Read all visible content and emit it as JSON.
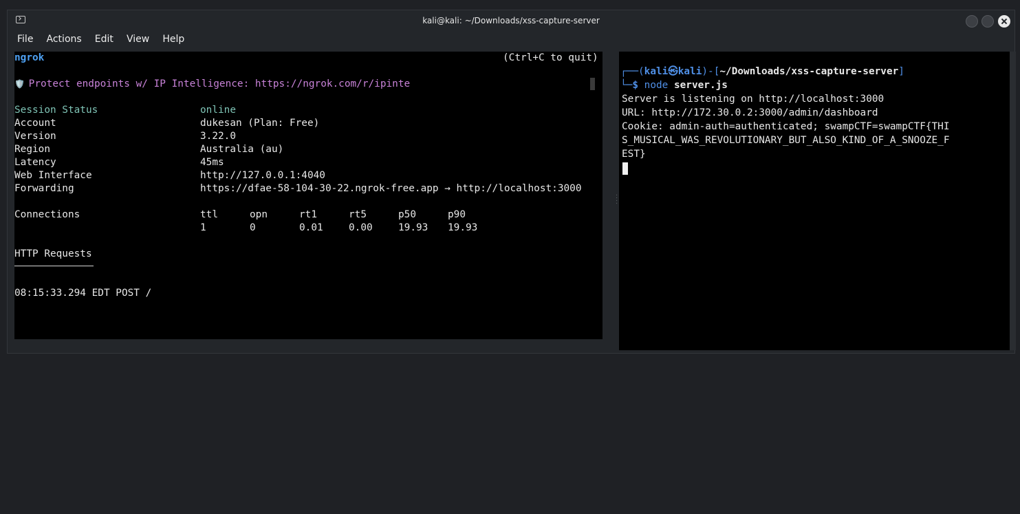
{
  "window": {
    "title": "kali@kali: ~/Downloads/xss-capture-server",
    "icon": "terminal-icon"
  },
  "menu": [
    "File",
    "Actions",
    "Edit",
    "View",
    "Help"
  ],
  "left_terminal": {
    "header_left": "ngrok",
    "header_right": "(Ctrl+C to quit)",
    "banner_icon": "🛡️",
    "banner": " Protect endpoints w/ IP Intelligence: https://ngrok.com/r/ipinte",
    "status": [
      {
        "label": "Session Status",
        "value": "online"
      },
      {
        "label": "Account",
        "value": "dukesan (Plan: Free)"
      },
      {
        "label": "Version",
        "value": "3.22.0"
      },
      {
        "label": "Region",
        "value": "Australia (au)"
      },
      {
        "label": "Latency",
        "value": "45ms"
      },
      {
        "label": "Web Interface",
        "value": "http://127.0.0.1:4040"
      },
      {
        "label": "Forwarding",
        "value": "https://dfae-58-104-30-22.ngrok-free.app → http://localhost:3000"
      }
    ],
    "connections_label": "Connections",
    "connections_headers": [
      "ttl",
      "opn",
      "rt1",
      "rt5",
      "p50",
      "p90"
    ],
    "connections_values": [
      "1",
      "0",
      "0.01",
      "0.00",
      "19.93",
      "19.93"
    ],
    "http_requests_label": "HTTP Requests",
    "request_line": "08:15:33.294 EDT POST /"
  },
  "right_terminal": {
    "prompt_top_prefix": "┌──(",
    "prompt_user": "kali",
    "prompt_at": "㉿",
    "prompt_host": "kali",
    "prompt_mid": ")-[",
    "prompt_path": "~/Downloads/xss-capture-server",
    "prompt_close": "]",
    "prompt_bottom_prefix": "└─",
    "prompt_dollar": "$ ",
    "cmd_node": "node",
    "cmd_arg": " server.js",
    "output": [
      "Server is listening on http://localhost:3000",
      "URL: http://172.30.0.2:3000/admin/dashboard",
      "Cookie: admin-auth=authenticated; swampCTF=swampCTF{THI",
      "S_MUSICAL_WAS_REVOLUTIONARY_BUT_ALSO_KIND_OF_A_SNOOZE_F",
      "EST}"
    ]
  }
}
